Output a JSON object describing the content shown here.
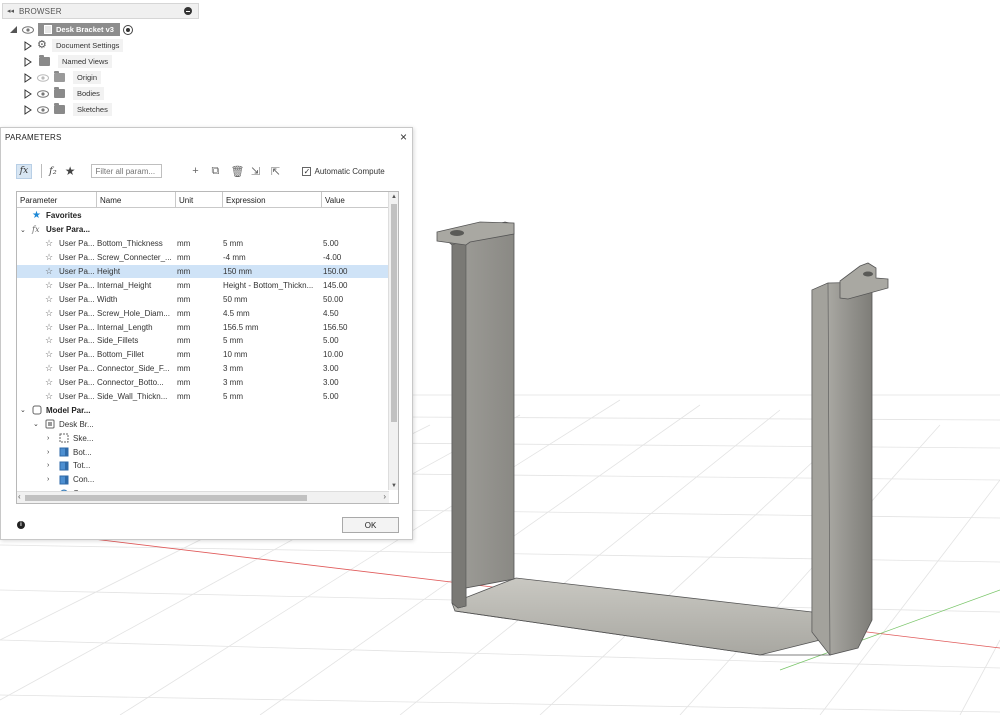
{
  "browser": {
    "header_title": "BROWSER",
    "collapse_glyph": "◂◂",
    "root_label": "Desk Bracket v3",
    "items": [
      {
        "label": "Document Settings",
        "icon": "gear-icon"
      },
      {
        "label": "Named Views",
        "icon": "folder-icon"
      },
      {
        "label": "Origin",
        "icon": "folder-icon"
      },
      {
        "label": "Bodies",
        "icon": "folder-icon"
      },
      {
        "label": "Sketches",
        "icon": "folder-icon"
      }
    ]
  },
  "dialog": {
    "title": "PARAMETERS",
    "close_glyph": "×",
    "filter_placeholder": "Filter all param...",
    "automatic_compute_label": "Automatic Compute",
    "automatic_compute_checked": true,
    "ok_label": "OK",
    "info_glyph": "i",
    "columns": [
      "Parameter",
      "Name",
      "Unit",
      "Expression",
      "Value"
    ],
    "favorites_label": "Favorites",
    "user_group_label": "User Para...",
    "user_params": [
      {
        "param": "User Pa...",
        "name": "Bottom_Thickness",
        "unit": "mm",
        "expr": "5 mm",
        "value": "5.00",
        "selected": false
      },
      {
        "param": "User Pa...",
        "name": "Screw_Connecter_...",
        "unit": "mm",
        "expr": "-4 mm",
        "value": "-4.00",
        "selected": false
      },
      {
        "param": "User Pa...",
        "name": "Height",
        "unit": "mm",
        "expr": "150 mm",
        "value": "150.00",
        "selected": true
      },
      {
        "param": "User Pa...",
        "name": "Internal_Height",
        "unit": "mm",
        "expr": "Height - Bottom_Thickn...",
        "value": "145.00",
        "selected": false
      },
      {
        "param": "User Pa...",
        "name": "Width",
        "unit": "mm",
        "expr": "50 mm",
        "value": "50.00",
        "selected": false
      },
      {
        "param": "User Pa...",
        "name": "Screw_Hole_Diam...",
        "unit": "mm",
        "expr": "4.5 mm",
        "value": "4.50",
        "selected": false
      },
      {
        "param": "User Pa...",
        "name": "Internal_Length",
        "unit": "mm",
        "expr": "156.5 mm",
        "value": "156.50",
        "selected": false
      },
      {
        "param": "User Pa...",
        "name": "Side_Fillets",
        "unit": "mm",
        "expr": "5 mm",
        "value": "5.00",
        "selected": false
      },
      {
        "param": "User Pa...",
        "name": "Bottom_Fillet",
        "unit": "mm",
        "expr": "10 mm",
        "value": "10.00",
        "selected": false
      },
      {
        "param": "User Pa...",
        "name": "Connector_Side_F...",
        "unit": "mm",
        "expr": "3 mm",
        "value": "3.00",
        "selected": false
      },
      {
        "param": "User Pa...",
        "name": "Connector_Botto...",
        "unit": "mm",
        "expr": "3 mm",
        "value": "3.00",
        "selected": false
      },
      {
        "param": "User Pa...",
        "name": "Side_Wall_Thickn...",
        "unit": "mm",
        "expr": "5 mm",
        "value": "5.00",
        "selected": false
      }
    ],
    "model_group_label": "Model Par...",
    "model_component_label": "Desk Br...",
    "model_children": [
      "Ske...",
      "Bot...",
      "Tot...",
      "Con...",
      "Con..."
    ]
  },
  "colors": {
    "selection": "#cfe3f7",
    "favorites_star": "#1e88d6",
    "grid_red": "#e05a5a",
    "grid_green": "#7ac66a",
    "part_gray": "#8a8a85"
  }
}
